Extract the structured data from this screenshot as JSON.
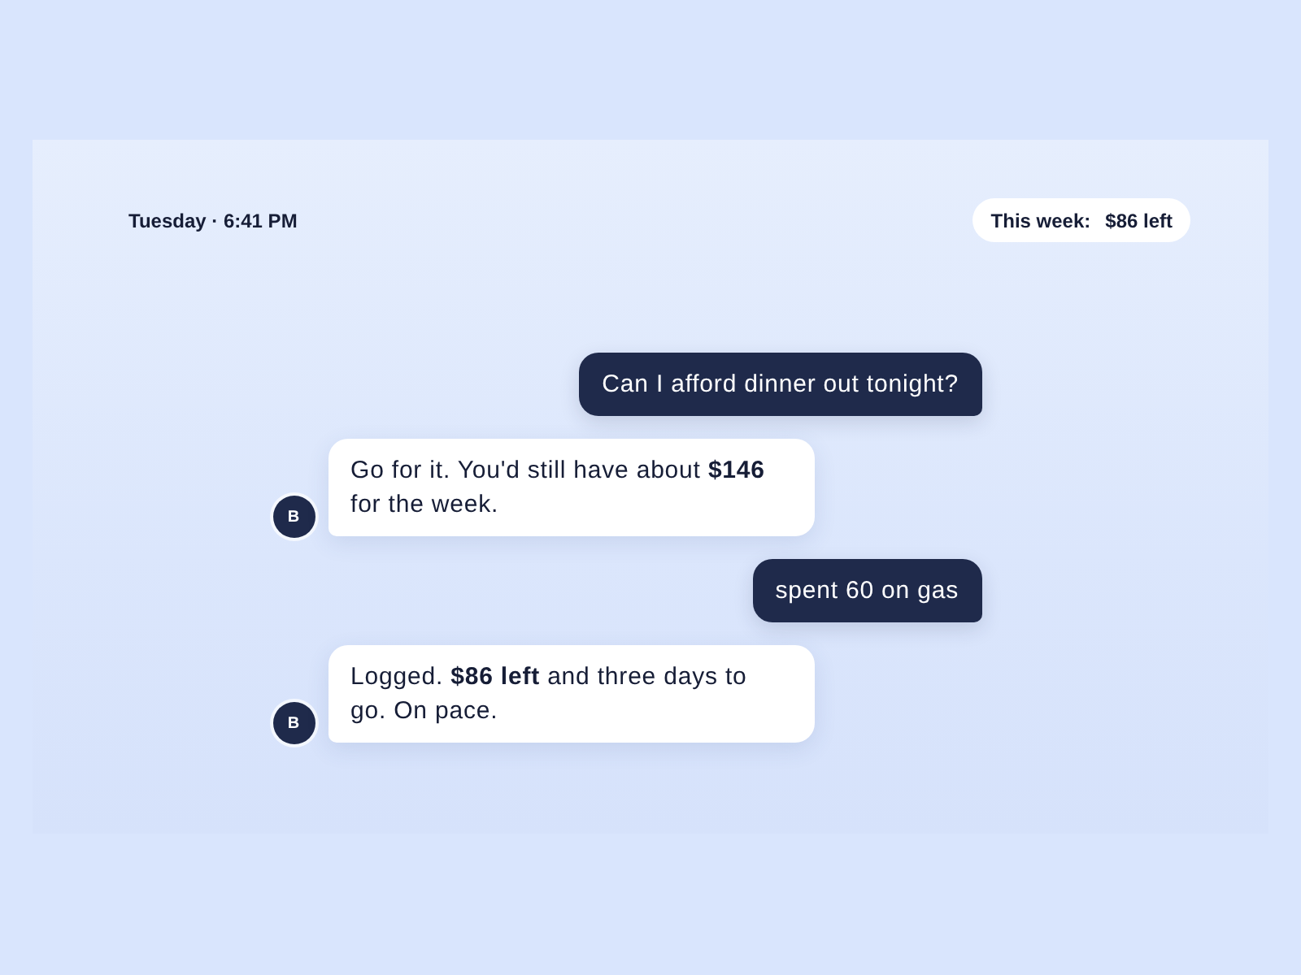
{
  "header": {
    "time": "Tuesday · 6:41 PM",
    "budget_pill": {
      "label": "This week:",
      "value": "$86 left"
    }
  },
  "messages": [
    {
      "kind": "user",
      "text": "Can I afford dinner out tonight?"
    },
    {
      "kind": "bot",
      "avatar": "B",
      "text": "Go for it. You'd still have about **$146** for the week."
    },
    {
      "kind": "user",
      "text": "spent 60 on gas"
    },
    {
      "kind": "bot",
      "avatar": "B",
      "text": "Logged. **$86 left** and three days to go. On pace."
    }
  ]
}
